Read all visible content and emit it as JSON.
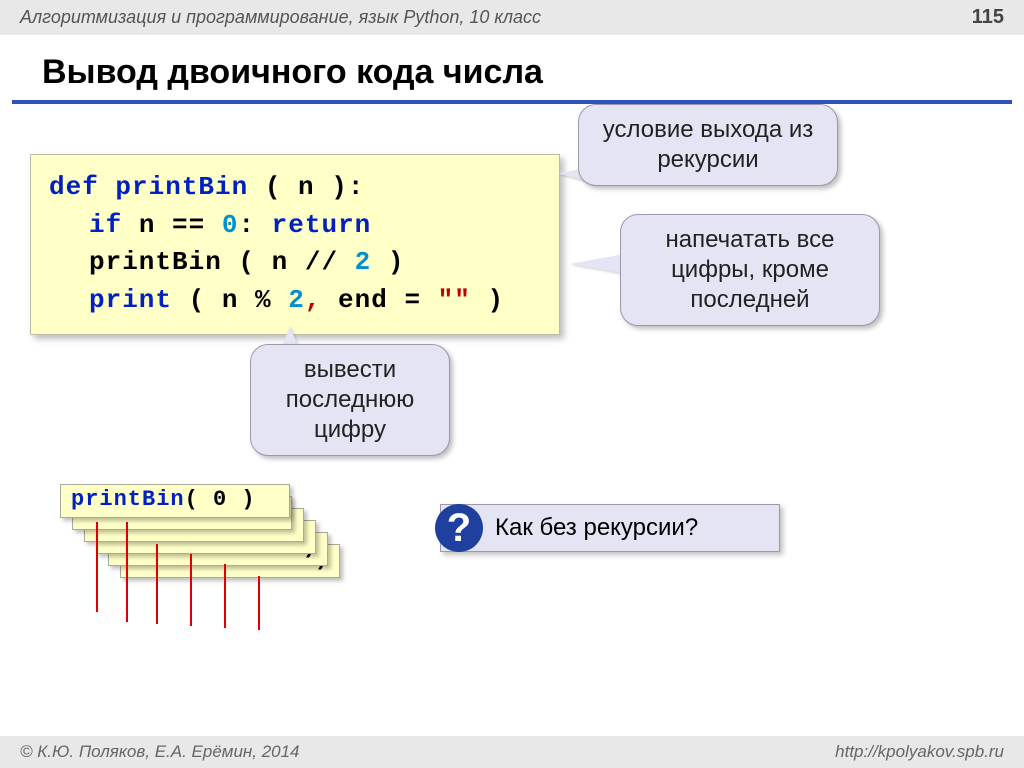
{
  "header": {
    "subject": "Алгоритмизация и программирование, язык Python, 10 класс",
    "page": "115"
  },
  "title": "Вывод двоичного кода числа",
  "code": {
    "l1_def": "def",
    "l1_name": "printBin",
    "l1_open": " ( n ):",
    "l2_if": "if",
    "l2_cond": " n == ",
    "l2_zero": "0",
    "l2_colon": ": ",
    "l2_return": "return",
    "l3_call": "printBin",
    "l3_args": " ( n // ",
    "l3_two": "2",
    "l3_close": " )",
    "l4_print": "print",
    "l4_open": " ( n % ",
    "l4_two": "2",
    "l4_comma": ",",
    "l4_end": " end = ",
    "l4_str": "\"\"",
    "l4_close": " )"
  },
  "callouts": {
    "c1": "условие выхода из рекурсии",
    "c2": "напечатать все цифры, кроме последней",
    "c3": "вывести последнюю цифру"
  },
  "stack_top": {
    "name": "printBin",
    "arg": "( 0 )",
    "close_paren": ")"
  },
  "question": "Как без рекурсии?",
  "footer": {
    "left": "© К.Ю. Поляков, Е.А. Ерёмин, 2014",
    "right": "http://kpolyakov.spb.ru"
  }
}
